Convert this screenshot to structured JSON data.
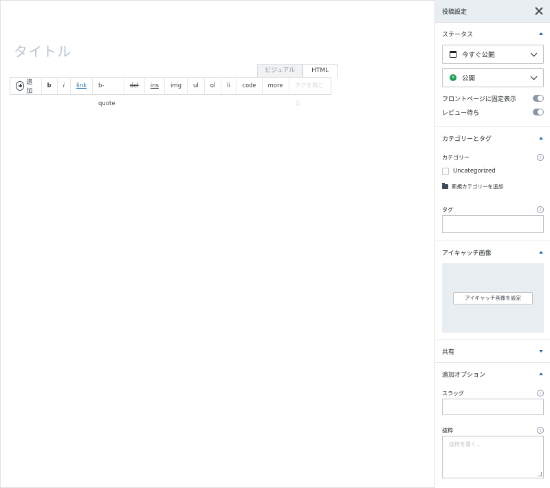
{
  "editor": {
    "title_placeholder": "タイトル",
    "tabs": [
      {
        "label": "ビジュアル"
      },
      {
        "label": "HTML"
      }
    ],
    "toolbar": {
      "add_label": "追加",
      "buttons": [
        "b",
        "i",
        "link",
        "b-quote",
        "del",
        "ins",
        "img",
        "ul",
        "ol",
        "li",
        "code",
        "more",
        "タグを閉じる"
      ]
    }
  },
  "sidebar": {
    "header_title": "投稿設定",
    "status": {
      "heading": "ステータス",
      "schedule_label": "今すぐ公開",
      "visibility_label": "公開",
      "sticky_label": "フロントページに固定表示",
      "pending_label": "レビュー待ち"
    },
    "categories": {
      "heading": "カテゴリーとタグ",
      "category_label": "カテゴリー",
      "items": [
        {
          "label": "Uncategorized"
        }
      ],
      "add_label": "新規カテゴリーを追加",
      "tags_label": "タグ"
    },
    "featured": {
      "heading": "アイキャッチ画像",
      "button_label": "アイキャッチ画像を設定"
    },
    "sharing": {
      "heading": "共有"
    },
    "more_options": {
      "heading": "追加オプション",
      "slug_label": "スラッグ",
      "excerpt_label": "抜粋",
      "excerpt_placeholder": "抜粋を書く…"
    }
  }
}
